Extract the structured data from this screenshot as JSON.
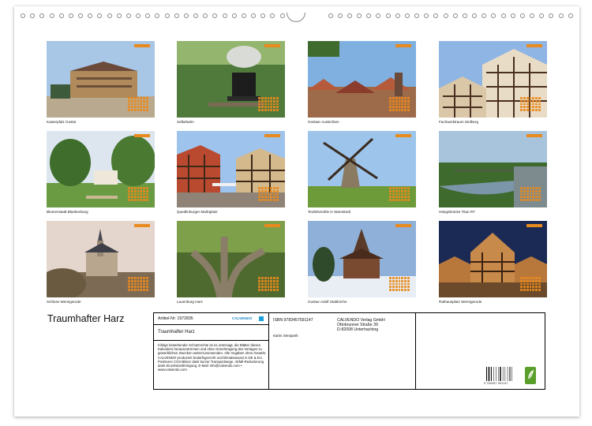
{
  "calendar_title": "Traumhafter Harz",
  "photos": [
    {
      "caption": "Kaiserpfalz Goslar",
      "scene": "palace"
    },
    {
      "caption": "Selkebahn",
      "scene": "train"
    },
    {
      "caption": "Goslaer Aussichten",
      "scene": "town"
    },
    {
      "caption": "Fachwerktraum Stolberg",
      "scene": "timber"
    },
    {
      "caption": "Blumenstadt Blankenburg",
      "scene": "garden"
    },
    {
      "caption": "Quedlinburger Marktplatz",
      "scene": "square"
    },
    {
      "caption": "Teufelsmühle in Warnstedt",
      "scene": "windmill"
    },
    {
      "caption": "Hängebrücke Titan RT",
      "scene": "bridge"
    },
    {
      "caption": "Schloss Wernigerode",
      "scene": "castle"
    },
    {
      "caption": "Lauenburg Harz",
      "scene": "tree"
    },
    {
      "caption": "Gustav-Adolf Stabkirche",
      "scene": "church"
    },
    {
      "caption": "Rathausplatz Wernigerode",
      "scene": "townhall"
    }
  ],
  "info": {
    "article_no": "Artikel-Nr: 1972835",
    "title": "Traumhafter Harz",
    "legal_text": "Infolge bestehender Schutzrechte ist es untersagt, die Blätter dieses Kalenders herauszutrennen und ohne Genehmigung des Verlages zu gewerblichen Zwecken weiterzuverwenden. Alle Angaben ohne Gewähr. CALVENDO produziert bedarfsgerecht und klimabewusst in DE & EU. Positivere CO2-Bilanz dank kurzer Transportwege. Abfall-Reduzierung dank Einzelstückfertigung. E-Mail: info@calvendo.com • www.calvendo.com",
    "isbn": "ISBN 9783457591147",
    "author": "Katrin Streiparth",
    "publisher_name": "CALVENDO Verlag GmbH",
    "publisher_street": "Ottobrunner Straße 39",
    "publisher_city": "D-82008 Unterhaching",
    "logo_text": "CALVENDO",
    "barcode_number": "9 783457 591147"
  },
  "colors": {
    "calendar_accent": "#e88a1e",
    "logo_blue": "#1a86c8",
    "eco_green": "#5a9e2b"
  }
}
